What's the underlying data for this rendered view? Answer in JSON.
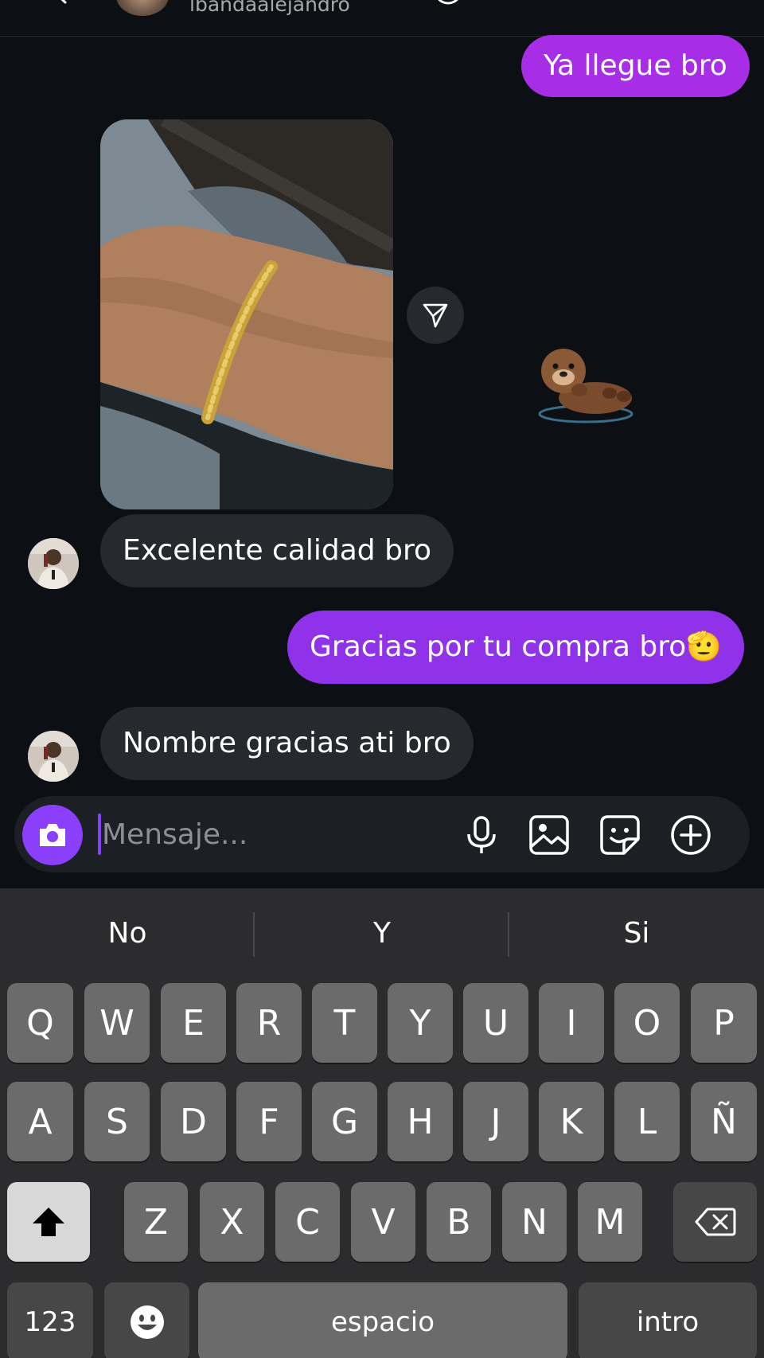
{
  "header": {
    "username": "lbandaalejandro"
  },
  "messages": [
    {
      "side": "out",
      "text": "Ya llegue bro"
    },
    {
      "side": "in",
      "text": "Excelente calidad bro"
    },
    {
      "side": "out",
      "text": "Gracias por tu compra bro🫡"
    },
    {
      "side": "in",
      "text": "Nombre gracias ati bro"
    }
  ],
  "composer": {
    "placeholder": "Mensaje..."
  },
  "keyboard": {
    "suggestions": [
      "No",
      "Y",
      "Si"
    ],
    "rows": [
      [
        "Q",
        "W",
        "E",
        "R",
        "T",
        "Y",
        "U",
        "I",
        "O",
        "P"
      ],
      [
        "A",
        "S",
        "D",
        "F",
        "G",
        "H",
        "J",
        "K",
        "L",
        "Ñ"
      ],
      [
        "Z",
        "X",
        "C",
        "V",
        "B",
        "N",
        "M"
      ]
    ],
    "numbers_label": "123",
    "space_label": "espacio",
    "return_label": "intro"
  },
  "colors": {
    "background": "#0c1014",
    "outgoing_bubble": "#8f32ea",
    "incoming_bubble": "#26292e",
    "accent": "#8a3ffc",
    "keyboard_bg": "#2c2c2e"
  },
  "icons": [
    "back-arrow-icon",
    "audio-call-icon",
    "video-call-icon",
    "flag-icon",
    "tag-icon",
    "share-icon",
    "camera-icon",
    "microphone-icon",
    "gallery-icon",
    "sticker-icon",
    "plus-icon",
    "shift-icon",
    "backspace-icon",
    "emoji-icon"
  ]
}
